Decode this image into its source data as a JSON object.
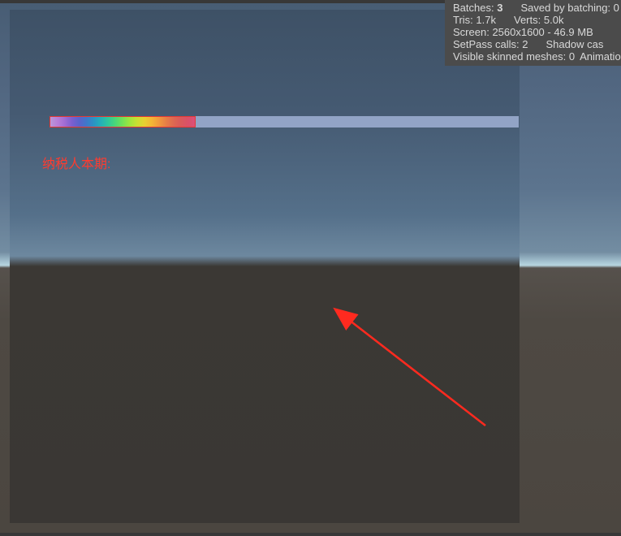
{
  "game": {
    "taxpayer_label": "纳税人本期:",
    "slider": {
      "min": 0,
      "max": 1,
      "value": 0.31
    }
  },
  "stats": {
    "batches_label": "Batches:",
    "batches": "3",
    "saved_by_batching_label": "Saved by batching:",
    "saved_by_batching": "0",
    "tris_label": "Tris:",
    "tris": "1.7k",
    "verts_label": "Verts:",
    "verts": "5.0k",
    "screen_label": "Screen:",
    "screen": "2560x1600 - 46.9 MB",
    "setpass_label": "SetPass calls:",
    "setpass": "2",
    "shadow_label": "Shadow cas",
    "skinned_label": "Visible skinned meshes:",
    "skinned": "0",
    "animations_label": "Animations"
  }
}
